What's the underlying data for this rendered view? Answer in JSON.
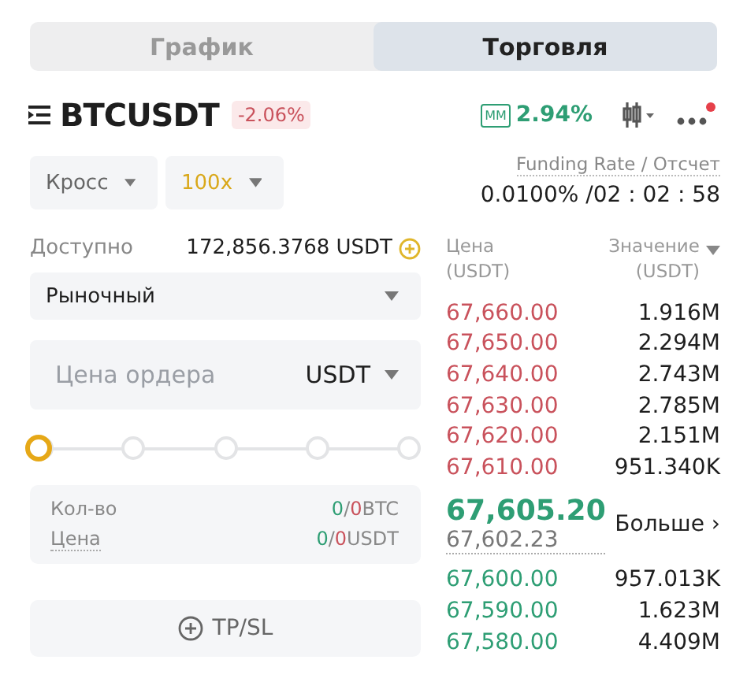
{
  "tabs": [
    {
      "label": "График",
      "selected": false
    },
    {
      "label": "Торговля",
      "selected": true
    }
  ],
  "header": {
    "symbol": "BTCUSDT",
    "change": "-2.06%",
    "mm_badge": "MM",
    "mm_ratio": "2.94%",
    "notification_dot": true
  },
  "margin_mode": {
    "value": "Кросс"
  },
  "leverage": {
    "value": "100x"
  },
  "funding": {
    "label": "Funding Rate / Отсчет",
    "value": "0.0100% /02 : 02 : 58"
  },
  "available": {
    "label": "Доступно",
    "value": "172,856.3768 USDT"
  },
  "order_type": {
    "value": "Рыночный"
  },
  "price_field": {
    "placeholder": "Цена ордера",
    "unit": "USDT"
  },
  "slider": {
    "level": 0
  },
  "summary": [
    {
      "label": "Кол-во",
      "buy": "0",
      "separator": "/",
      "sell": "0",
      "unit": "BTC"
    },
    {
      "label": "Цена",
      "buy": "0",
      "separator": "/",
      "sell": "0",
      "unit": "USDT"
    }
  ],
  "tpsl_button": {
    "label": "TP/SL"
  },
  "orderbook": {
    "columns": [
      {
        "lines": [
          "Цена",
          "(USDT)"
        ]
      },
      {
        "lines": [
          "Значение",
          "(USDT)"
        ]
      }
    ],
    "rows": [
      {
        "kind": "ask",
        "price": "67,660.00",
        "value": "1.916M"
      },
      {
        "kind": "ask",
        "price": "67,650.00",
        "value": "2.294M"
      },
      {
        "kind": "ask",
        "price": "67,640.00",
        "value": "2.743M"
      },
      {
        "kind": "ask",
        "price": "67,630.00",
        "value": "2.785M"
      },
      {
        "kind": "ask",
        "price": "67,620.00",
        "value": "2.151M"
      },
      {
        "kind": "ask",
        "price": "67,610.00",
        "value": "951.340K"
      },
      {
        "kind": "mid",
        "price": "67,605.20",
        "mark_price": "67,602.23",
        "more": "Больше",
        "more_arrow": "›"
      },
      {
        "kind": "bid",
        "price": "67,600.00",
        "value": "957.013K"
      },
      {
        "kind": "bid",
        "price": "67,590.00",
        "value": "1.623M"
      },
      {
        "kind": "bid",
        "price": "67,580.00",
        "value": "4.409M"
      }
    ]
  }
}
